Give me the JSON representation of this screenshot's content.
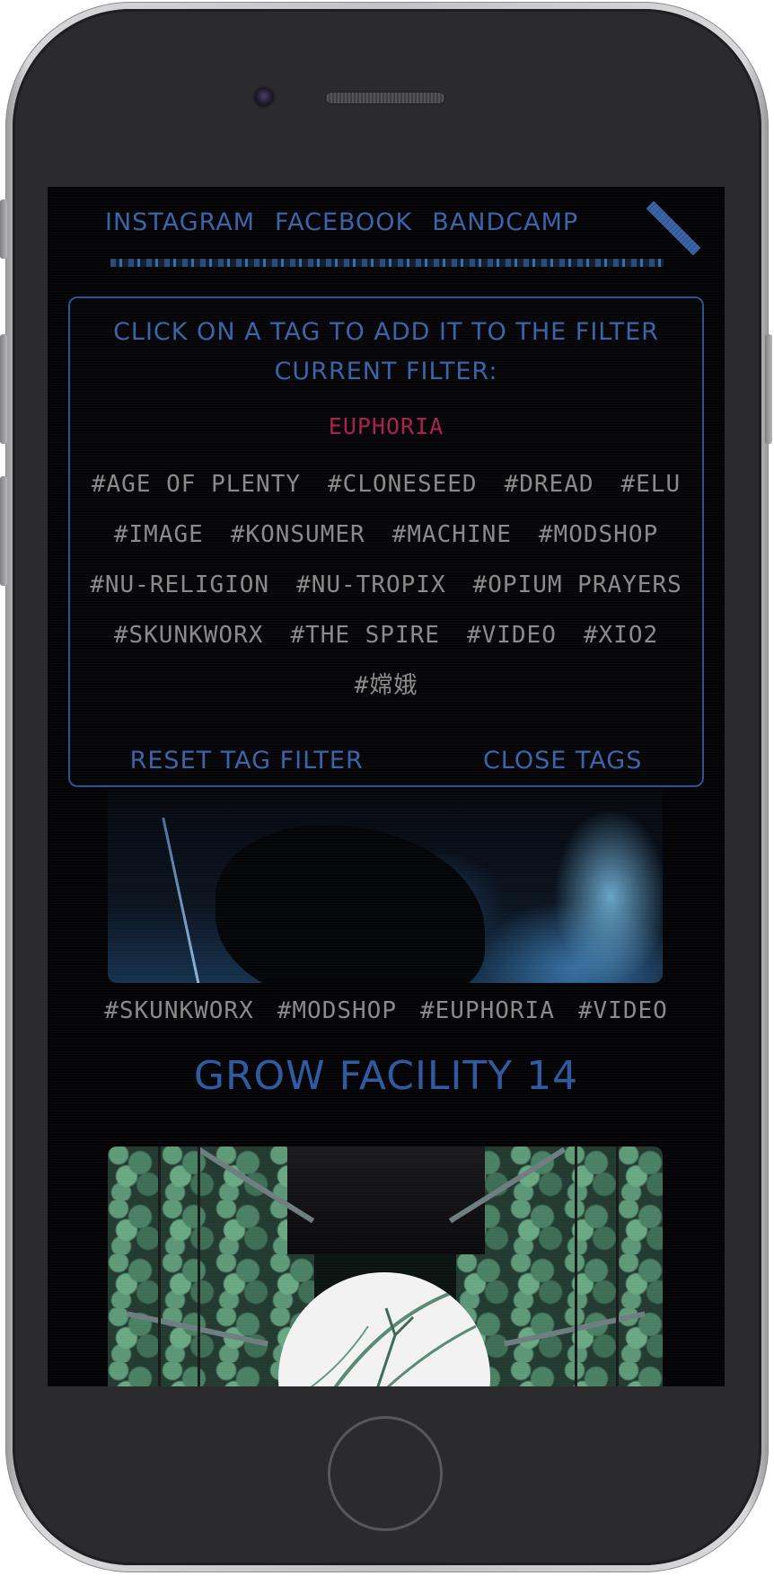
{
  "nav": {
    "links": [
      "INSTAGRAM",
      "FACEBOOK",
      "BANDCAMP"
    ],
    "menu_icon": "hamburger-slash-icon"
  },
  "tag_panel": {
    "instruction": "CLICK ON A TAG TO ADD IT TO THE FILTER",
    "filter_label": "CURRENT FILTER:",
    "active_filter": "EUPHORIA",
    "tags": [
      "#AGE OF PLENTY",
      "#CLONESEED",
      "#DREAD",
      "#ELU",
      "#IMAGE",
      "#KONSUMER",
      "#MACHINE",
      "#MODSHOP",
      "#NU-RELIGION",
      "#NU-TROPIX",
      "#OPIUM PRAYERS",
      "#SKUNKWORX",
      "#THE SPIRE",
      "#VIDEO",
      "#XIO2",
      "#嫦娥"
    ],
    "reset_label": "RESET TAG FILTER",
    "close_label": "CLOSE TAGS"
  },
  "posts": [
    {
      "tags": [
        "#SKUNKWORX",
        "#MODSHOP",
        "#EUPHORIA",
        "#VIDEO"
      ]
    },
    {
      "title": "GROW FACILITY 14"
    }
  ],
  "colors": {
    "accent_blue": "#3a63a8",
    "active_filter": "#a8234c",
    "tag_gray": "#8a8a8a",
    "screen_bg": "#040406"
  }
}
